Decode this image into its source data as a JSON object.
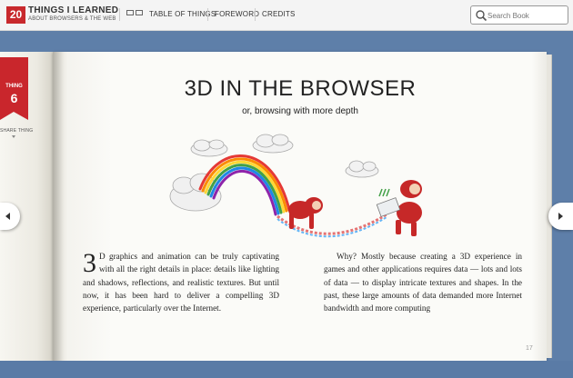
{
  "header": {
    "logo_number": "20",
    "logo_title": "THINGS I LEARNED",
    "logo_subtitle": "ABOUT BROWSERS & THE WEB",
    "nav": [
      "TABLE OF THINGS",
      "FOREWORD",
      "CREDITS"
    ],
    "search_placeholder": "Search Book",
    "icons": [
      "table-of-things-icon",
      "search-icon"
    ]
  },
  "sidebar": {
    "ribbon_label": "THING",
    "ribbon_number": "6",
    "share_label": "SHARE THING"
  },
  "page": {
    "title": "3D IN THE BROWSER",
    "subtitle": "or, browsing with more depth",
    "dropcap": "3",
    "col1": "D graphics and animation can be truly captivating with all the right details in place: details like lighting and shadows, reflections, and realistic textures. But until now, it has been hard to deliver a compelling 3D experience, particularly over the Internet.",
    "col2": "Why? Mostly because creating a 3D experience in games and other applications requires data — lots and lots of data — to display intricate textures and shapes. In the past, these large amounts of data demanded more Internet bandwidth and more computing",
    "page_number": "17"
  },
  "colors": {
    "brand_red": "#c8292d",
    "background_blue": "#5e7fa9"
  }
}
